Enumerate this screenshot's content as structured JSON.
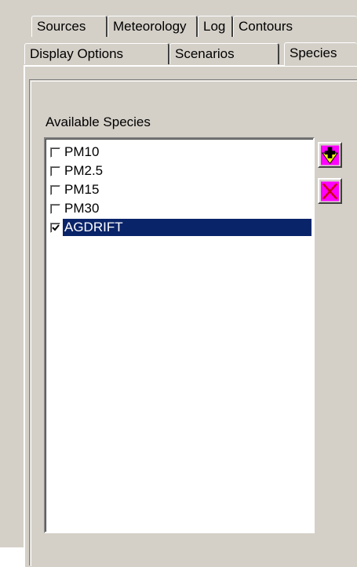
{
  "tabs": {
    "row1": [
      {
        "label": "Sources"
      },
      {
        "label": "Meteorology"
      },
      {
        "label": "Log"
      },
      {
        "label": "Contours"
      }
    ],
    "row2": [
      {
        "label": "Display Options"
      },
      {
        "label": "Scenarios"
      },
      {
        "label": "Species"
      }
    ],
    "active": "Species"
  },
  "species_panel": {
    "label": "Available Species",
    "items": [
      {
        "label": "PM10",
        "checked": false,
        "selected": false
      },
      {
        "label": "PM2.5",
        "checked": false,
        "selected": false
      },
      {
        "label": "PM15",
        "checked": false,
        "selected": false
      },
      {
        "label": "PM30",
        "checked": false,
        "selected": false
      },
      {
        "label": "AGDRIFT",
        "checked": true,
        "selected": true
      }
    ],
    "add_button_icon": "add-icon",
    "delete_button_icon": "delete-icon"
  },
  "colors": {
    "selection_bg": "#0a246a",
    "button_face": "#ff00ff",
    "add_icon_fill": "#ffff00"
  }
}
